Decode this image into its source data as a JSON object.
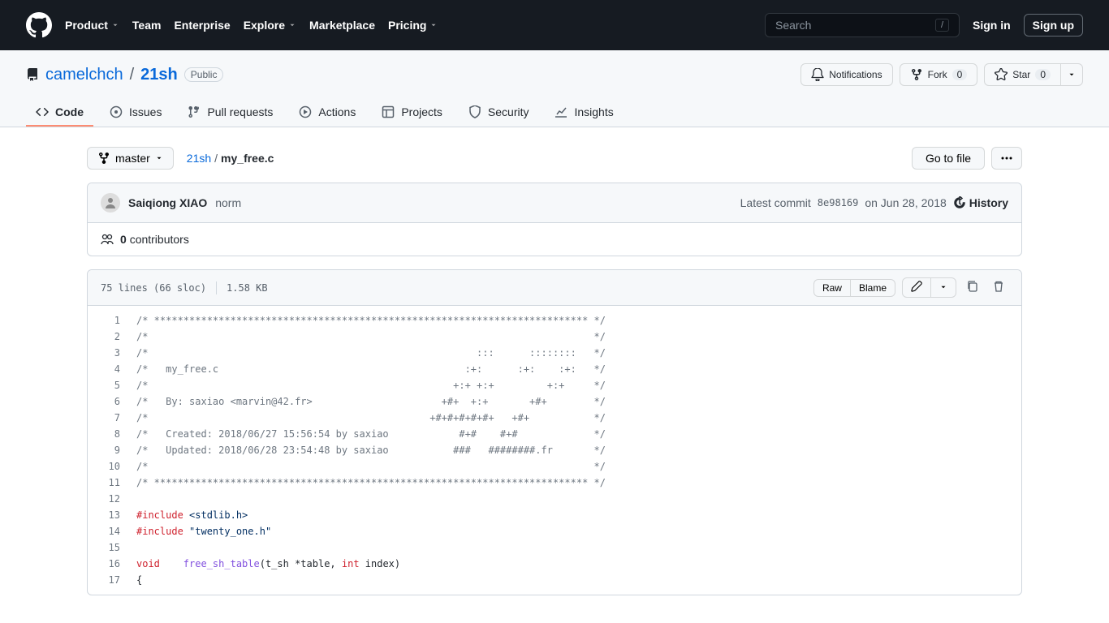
{
  "nav": {
    "product": "Product",
    "team": "Team",
    "enterprise": "Enterprise",
    "explore": "Explore",
    "marketplace": "Marketplace",
    "pricing": "Pricing"
  },
  "search": {
    "placeholder": "Search",
    "slash": "/"
  },
  "auth": {
    "signin": "Sign in",
    "signup": "Sign up"
  },
  "repo": {
    "owner": "camelchch",
    "name": "21sh",
    "visibility": "Public"
  },
  "actions": {
    "notifications": "Notifications",
    "fork": "Fork",
    "fork_count": "0",
    "star": "Star",
    "star_count": "0"
  },
  "tabs": {
    "code": "Code",
    "issues": "Issues",
    "pulls": "Pull requests",
    "actions": "Actions",
    "projects": "Projects",
    "security": "Security",
    "insights": "Insights"
  },
  "branch": "master",
  "breadcrumb": {
    "root": "21sh",
    "file": "my_free.c"
  },
  "buttons": {
    "gotofile": "Go to file",
    "raw": "Raw",
    "blame": "Blame"
  },
  "commit": {
    "author": "Saiqiong XIAO",
    "message": "norm",
    "prefix": "Latest commit",
    "sha": "8e98169",
    "date": "on Jun 28, 2018",
    "history": "History"
  },
  "contributors": {
    "count": "0",
    "label": "contributors"
  },
  "fileinfo": {
    "lines": "75 lines (66 sloc)",
    "size": "1.58 KB"
  },
  "code": {
    "line_start": 1,
    "line_end": 17,
    "lines": [
      {
        "type": "comment",
        "text": "/* ************************************************************************** */"
      },
      {
        "type": "comment",
        "text": "/*                                                                            */"
      },
      {
        "type": "comment",
        "text": "/*                                                        :::      ::::::::   */"
      },
      {
        "type": "comment",
        "text": "/*   my_free.c                                          :+:      :+:    :+:   */"
      },
      {
        "type": "comment",
        "text": "/*                                                    +:+ +:+         +:+     */"
      },
      {
        "type": "comment",
        "text": "/*   By: saxiao <marvin@42.fr>                      +#+  +:+       +#+        */"
      },
      {
        "type": "comment",
        "text": "/*                                                +#+#+#+#+#+   +#+           */"
      },
      {
        "type": "comment",
        "text": "/*   Created: 2018/06/27 15:56:54 by saxiao            #+#    #+#             */"
      },
      {
        "type": "comment",
        "text": "/*   Updated: 2018/06/28 23:54:48 by saxiao           ###   ########.fr       */"
      },
      {
        "type": "comment",
        "text": "/*                                                                            */"
      },
      {
        "type": "comment",
        "text": "/* ************************************************************************** */"
      },
      {
        "type": "blank",
        "text": ""
      },
      {
        "type": "include",
        "keyword": "#include ",
        "target": "<stdlib.h>"
      },
      {
        "type": "include",
        "keyword": "#include ",
        "target": "\"twenty_one.h\""
      },
      {
        "type": "blank",
        "text": ""
      },
      {
        "type": "funcdef",
        "ret": "void",
        "name": "free_sh_table",
        "params_open": "(t_sh *table, ",
        "int_kw": "int",
        "params_close": " index)"
      },
      {
        "type": "plain",
        "text": "{"
      }
    ]
  }
}
